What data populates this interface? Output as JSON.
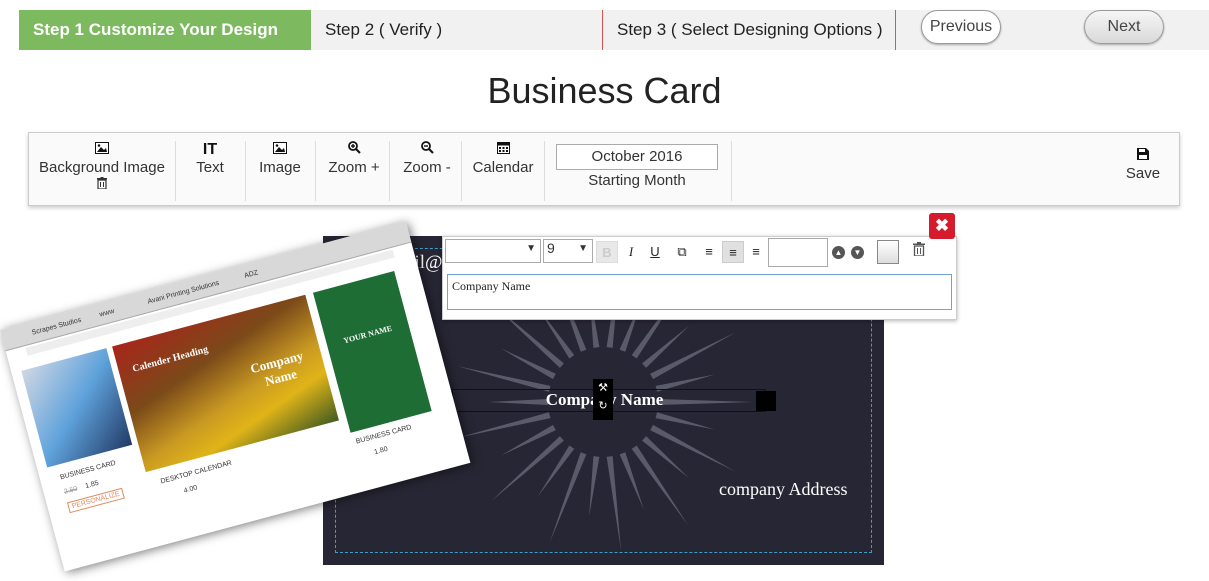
{
  "steps": [
    {
      "label": "Step 1 Customize Your Design"
    },
    {
      "label": "Step 2 ( Verify )"
    },
    {
      "label": "Step 3 ( Select Designing Options )"
    }
  ],
  "nav": {
    "previous": "Previous",
    "next": "Next"
  },
  "page_title": "Business Card",
  "toolbar": {
    "background_image": "Background Image",
    "text": "Text",
    "image": "Image",
    "zoom_in": "Zoom +",
    "zoom_out": "Zoom -",
    "calendar": "Calendar",
    "starting_month_value": "October 2016",
    "starting_month_label": "Starting Month",
    "save": "Save"
  },
  "card": {
    "email": "youremail@c",
    "company_name": "Company Name",
    "company_address": "company Address",
    "background_color": "#272634",
    "guide_color": "#3ea0c8"
  },
  "text_editor": {
    "font_family": "",
    "font_size": "9",
    "textarea_value": "Company Name",
    "close": "✖"
  },
  "promo": {
    "tabs": [
      "Scrapes Studios",
      "www",
      "Avani Printing Solutions",
      "ADZ"
    ],
    "products": [
      {
        "heading": "Calender Heading",
        "company": "Company Name",
        "caption": "DESKTOP CALENDAR",
        "price": "4.00"
      },
      {
        "caption": "BUSINESS CARD",
        "price": "1.85",
        "old_price": "2.50",
        "button": "PERSONALIZE"
      },
      {
        "heading": "YOUR NAME",
        "caption": "BUSINESS CARD",
        "price": "1.80"
      }
    ]
  },
  "colors": {
    "step_active": "#7dba5f",
    "step_divider": "#d9534f",
    "close": "#d41c2d"
  }
}
